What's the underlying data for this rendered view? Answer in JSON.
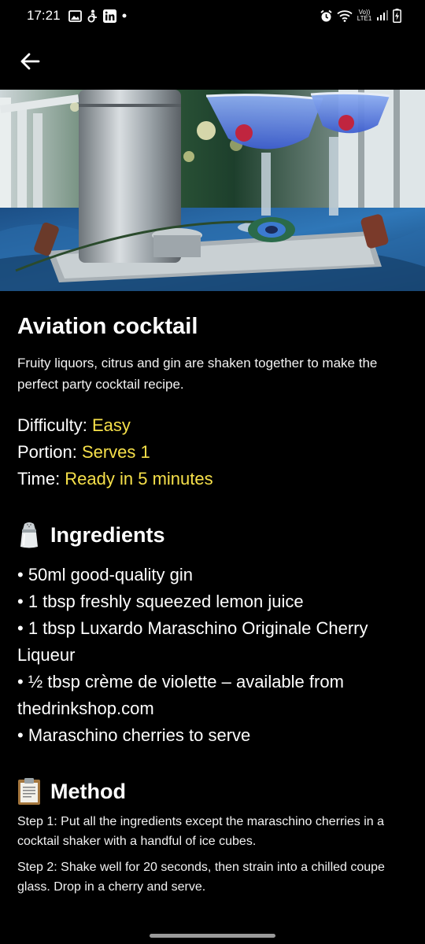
{
  "status_bar": {
    "time": "17:21",
    "network_label": "Vo)) LTE1",
    "left_icons": [
      "gallery-icon",
      "accessibility-icon",
      "linkedin-icon",
      "dot-icon"
    ],
    "right_icons": [
      "alarm-icon",
      "wifi-icon",
      "signal-icon",
      "battery-charging-icon"
    ]
  },
  "app_bar": {
    "back_icon": "arrow-left-icon"
  },
  "hero": {
    "image": "photo-aviation-cocktail-glasses-shaker-peacock-feather"
  },
  "recipe": {
    "title": "Aviation cocktail",
    "description": "Fruity liquors, citrus and gin are shaken together to make the perfect party cocktail recipe.",
    "difficulty_label": "Difficulty: ",
    "difficulty_value": "Easy",
    "portion_label": "Portion: ",
    "portion_value": "Serves 1",
    "time_label": "Time: ",
    "time_value": "Ready in 5 minutes"
  },
  "ingredients": {
    "icon": "salt-shaker-icon",
    "title": "Ingredients",
    "items": [
      "• 50ml good-quality gin",
      "• 1 tbsp freshly squeezed lemon juice",
      "• 1 tbsp Luxardo Maraschino Originale Cherry Liqueur",
      "• ½ tbsp crème de violette – available from thedrinkshop.com",
      "• Maraschino cherries to serve"
    ]
  },
  "method": {
    "icon": "clipboard-icon",
    "title": "Method",
    "steps": [
      "Step 1: Put all the ingredients except the maraschino cherries in a cocktail shaker with a handful of ice cubes.",
      "Step 2: Shake well for 20 seconds, then strain into a chilled coupe glass. Drop in a cherry and serve."
    ]
  },
  "colors": {
    "background": "#000000",
    "text": "#ffffff",
    "accent_value": "#f6e04a"
  }
}
